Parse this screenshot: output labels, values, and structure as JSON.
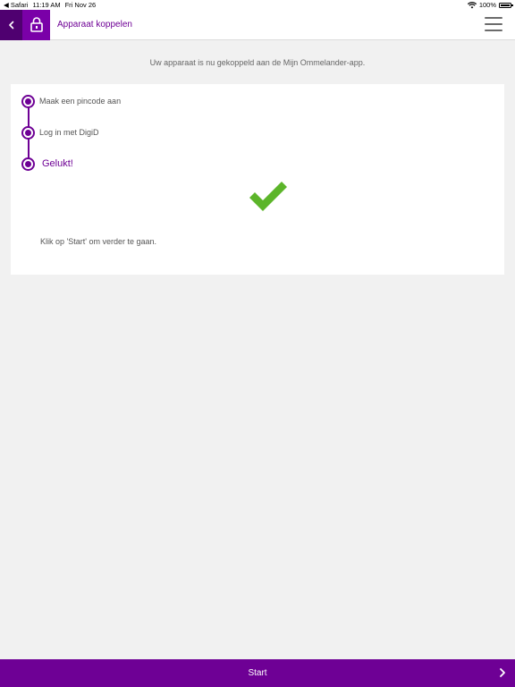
{
  "statusbar": {
    "app": "Safari",
    "time": "11:19 AM",
    "date": "Fri Nov 26",
    "battery": "100%"
  },
  "navbar": {
    "title": "Apparaat koppelen"
  },
  "intro": "Uw apparaat is nu gekoppeld aan de Mijn Ommelander-app.",
  "steps": [
    {
      "label": "Maak een pincode aan"
    },
    {
      "label": "Log in met DigiD"
    },
    {
      "label": "Gelukt!"
    }
  ],
  "hint": "Klik op 'Start' om verder te gaan.",
  "start": {
    "label": "Start"
  },
  "colors": {
    "brand": "#6e0095",
    "brand_dark": "#4f0070",
    "success": "#5cb52a"
  },
  "icons": [
    "back-chevron-icon",
    "lock-icon",
    "hamburger-menu-icon",
    "checkmark-icon",
    "chevron-right-icon",
    "wifi-icon",
    "battery-icon"
  ]
}
